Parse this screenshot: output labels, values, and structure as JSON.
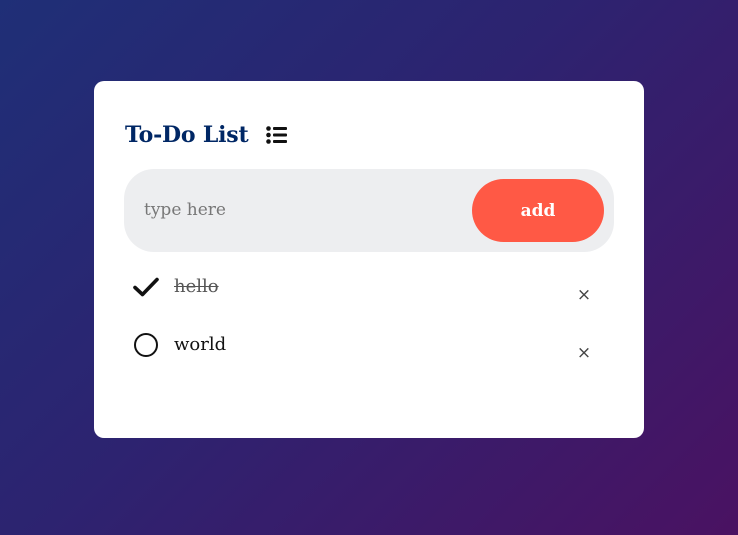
{
  "app": {
    "title": "To-Do List",
    "title_icon": "list-icon"
  },
  "input": {
    "placeholder": "type here",
    "value": ""
  },
  "add_button": {
    "label": "add",
    "color": "#ff5945"
  },
  "todos": [
    {
      "text": "hello",
      "done": true,
      "status_icon": "checkmark-icon",
      "remove_label": "×"
    },
    {
      "text": "world",
      "done": false,
      "status_icon": "unchecked-circle-icon",
      "remove_label": "×"
    }
  ],
  "colors": {
    "title": "#002765",
    "input_bg": "#edeef0",
    "accent": "#ff5945"
  }
}
